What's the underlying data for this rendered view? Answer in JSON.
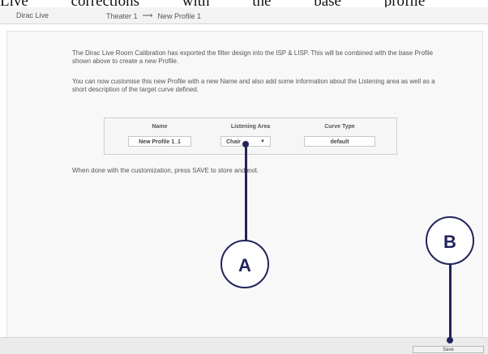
{
  "doc_text": "Live corrections with the base profile",
  "header": {
    "app_name": "Dirac Live",
    "crumb_from": "Theater 1",
    "crumb_to": "New Profile 1"
  },
  "main": {
    "paragraph1": "The Dirac Live Room Calibration has exported the filter design into the ISP & LISP. This will be combined with the base Profile shown above to create a new Profile.",
    "paragraph2": "You can now customise this new Profile with a new Name and also add some information about the Listening area as well as a short description of the target curve defined.",
    "paragraph3": "When done with the customization, press SAVE to store and exit.",
    "table": {
      "headers": [
        "Name",
        "Listening Area",
        "Curve Type"
      ],
      "name_value": "New Profile 1_1",
      "listening_area_value": "Chair",
      "curve_type_value": "default"
    }
  },
  "footer": {
    "save_label": "Save"
  },
  "callouts": {
    "a": "A",
    "b": "B"
  },
  "colors": {
    "callout": "#21235c"
  }
}
